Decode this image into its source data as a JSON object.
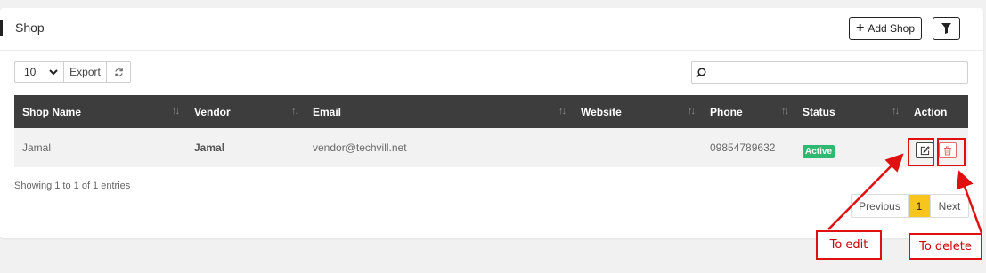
{
  "header": {
    "title": "Shop",
    "add_shop_label": "Add Shop"
  },
  "toolbar": {
    "page_length": "10",
    "export_label": "Export",
    "search_value": ""
  },
  "table": {
    "columns": [
      "Shop Name",
      "Vendor",
      "Email",
      "Website",
      "Phone",
      "Status",
      "Action"
    ],
    "rows": [
      {
        "shop_name": "Jamal",
        "vendor": "Jamal",
        "email": "vendor@techvill.net",
        "website": "",
        "phone": "09854789632",
        "status": "Active"
      }
    ]
  },
  "footer": {
    "info": "Showing 1 to 1 of 1 entries",
    "prev_label": "Previous",
    "current_page": "1",
    "next_label": "Next"
  },
  "annotations": {
    "edit_label": "To edit",
    "delete_label": "To delete"
  },
  "colors": {
    "header_bg": "#3d3d3d",
    "active_badge": "#2eb872",
    "current_page": "#f7c51e",
    "annotation_red": "#e01010"
  }
}
